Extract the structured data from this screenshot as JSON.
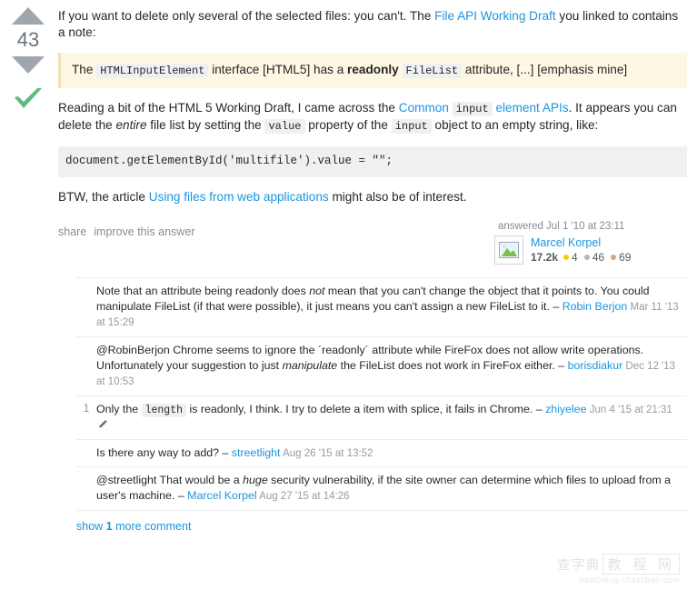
{
  "vote": {
    "count": "43",
    "up_icon": "triangle-up-icon",
    "down_icon": "triangle-down-icon",
    "accepted_icon": "checkmark-icon",
    "accent_color": "#5eba7d",
    "arrow_color": "#9fa6ad"
  },
  "answer": {
    "paragraph1": {
      "before_link": "If you want to delete only several of the selected files: you can't. The ",
      "link": "File API Working Draft",
      "after_link": " you linked to contains a note:"
    },
    "blockquote": {
      "t1": "The ",
      "code1": "HTMLInputElement",
      "t2": " interface [HTML5] has a ",
      "bold": "readonly",
      "t3": " ",
      "code2": "FileList",
      "t4": " attribute, [...] [emphasis mine]"
    },
    "paragraph2": {
      "t1": "Reading a bit of the HTML 5 Working Draft, I came across the ",
      "link_part1": "Common ",
      "link_code": "input",
      "link_part2": " element APIs",
      "t2": ". It appears you can delete the ",
      "italic": "entire",
      "t3": " file list by setting the ",
      "code1": "value",
      "t4": " property of the ",
      "code2": "input",
      "t5": " object to an empty string, like:"
    },
    "code_block": "document.getElementById('multifile').value = \"\";",
    "paragraph3": {
      "t1": "BTW, the article ",
      "link": "Using files from web applications",
      "t2": " might also be of interest."
    }
  },
  "post_menu": {
    "share": "share",
    "improve": "improve this answer"
  },
  "user_card": {
    "action_time": "answered Jul 1 '10 at 23:11",
    "avatar_icon": "broken-image-icon",
    "name": "Marcel Korpel",
    "reputation": "17.2k",
    "badges": [
      {
        "type": "gold",
        "count": "4",
        "color": "#ffcc01"
      },
      {
        "type": "silver",
        "count": "46",
        "color": "#b4b8bc"
      },
      {
        "type": "bronze",
        "count": "69",
        "color": "#d1a684"
      }
    ]
  },
  "comments": [
    {
      "score": "",
      "parts": [
        {
          "type": "text",
          "value": "Note that an attribute being readonly does "
        },
        {
          "type": "italic",
          "value": "not"
        },
        {
          "type": "text",
          "value": " mean that you can't change the object that it points to. You could manipulate FileList (if that were possible), it just means you can't assign a new FileList to it. – "
        }
      ],
      "user": "Robin Berjon",
      "date": "Mar 11 '13 at 15:29",
      "edited": false
    },
    {
      "score": "",
      "parts": [
        {
          "type": "text",
          "value": "@RobinBerjon Chrome seems to ignore the ´readonly´ attribute while FireFox does not allow write operations. Unfortunately your suggestion to just "
        },
        {
          "type": "italic",
          "value": "manipulate"
        },
        {
          "type": "text",
          "value": " the FileList does not work in FireFox either. – "
        }
      ],
      "user": "borisdiakur",
      "date": "Dec 12 '13 at 10:53",
      "edited": false
    },
    {
      "score": "1",
      "parts": [
        {
          "type": "text",
          "value": "Only the "
        },
        {
          "type": "code",
          "value": "length"
        },
        {
          "type": "text",
          "value": " is readonly, I think. I try to delete a item with splice, it fails in Chrome. – "
        }
      ],
      "user": "zhiyelee",
      "date": "Jun 4 '15 at 21:31",
      "edited": true,
      "edit_icon": "pencil-icon"
    },
    {
      "score": "",
      "parts": [
        {
          "type": "text",
          "value": "Is there any way to add? – "
        }
      ],
      "user": "streetlight",
      "date": "Aug 26 '15 at 13:52",
      "edited": false
    },
    {
      "score": "",
      "parts": [
        {
          "type": "text",
          "value": "@streetlight That would be a "
        },
        {
          "type": "italic",
          "value": "huge"
        },
        {
          "type": "text",
          "value": " security vulnerability, if the site owner can determine which files to upload from a user's machine. – "
        }
      ],
      "user": "Marcel Korpel",
      "date": "Aug 27 '15 at 14:26",
      "edited": false
    }
  ],
  "show_more": {
    "prefix": "show ",
    "count": "1",
    "suffix": " more comment"
  },
  "watermark": {
    "text_left": "查字典",
    "text_box": "教 程 网",
    "url": "jiaocheng.chazidian.com"
  }
}
